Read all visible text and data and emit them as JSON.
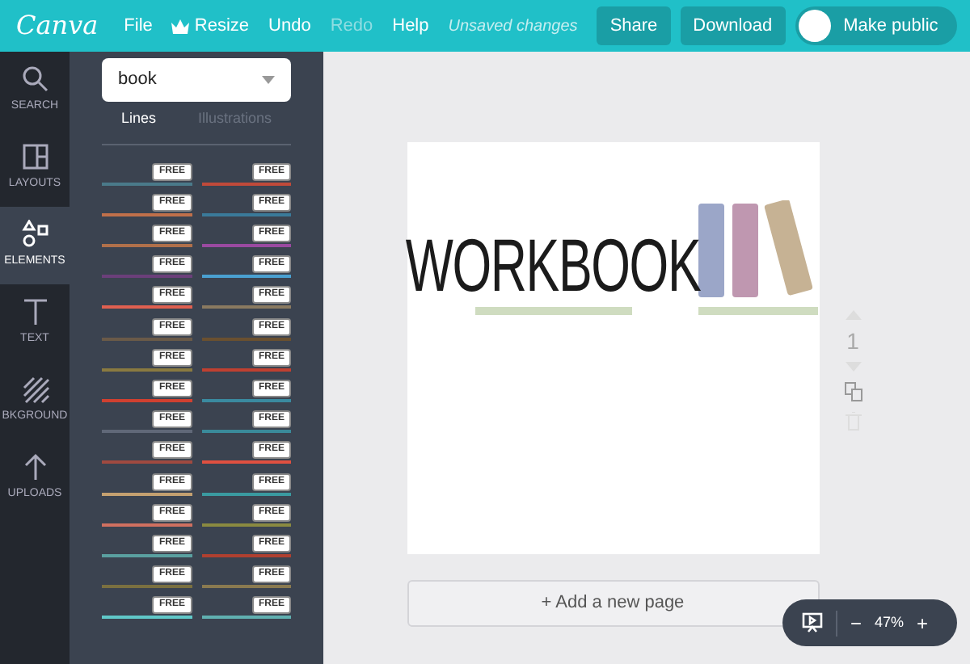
{
  "topbar": {
    "logo": "Canva",
    "menu": [
      {
        "label": "File",
        "disabled": false
      },
      {
        "label": "Resize",
        "disabled": false
      },
      {
        "label": "Undo",
        "disabled": false
      },
      {
        "label": "Redo",
        "disabled": true
      },
      {
        "label": "Help",
        "disabled": false
      }
    ],
    "status": "Unsaved changes",
    "buttons": [
      "Share",
      "Download"
    ],
    "toggle": {
      "label": "Make public",
      "on": false
    }
  },
  "rail": [
    {
      "label": "SEARCH",
      "selected": false
    },
    {
      "label": "LAYOUTS",
      "selected": false
    },
    {
      "label": "ELEMENTS",
      "selected": true
    },
    {
      "label": "TEXT",
      "selected": false
    },
    {
      "label": "BKGROUND",
      "selected": false
    },
    {
      "label": "UPLOADS",
      "selected": false
    }
  ],
  "panel": {
    "search": {
      "value": "book"
    },
    "tabs": [
      {
        "label": "Lines",
        "selected": true
      },
      {
        "label": "Illustrations",
        "selected": false
      }
    ],
    "lines": [
      {
        "badge": "FREE",
        "color": "#4a7a8a"
      },
      {
        "badge": "FREE",
        "color": "#c04a3a"
      },
      {
        "badge": "FREE",
        "color": "#c0704a"
      },
      {
        "badge": "FREE",
        "color": "#3a7a9a"
      },
      {
        "badge": "FREE",
        "color": "#b0704a"
      },
      {
        "badge": "FREE",
        "color": "#9a4aa0"
      },
      {
        "badge": "FREE",
        "color": "#6b3f7a"
      },
      {
        "badge": "FREE",
        "color": "#4aa0d0"
      },
      {
        "badge": "FREE",
        "color": "#e06050"
      },
      {
        "badge": "FREE",
        "color": "#8a7a60"
      },
      {
        "badge": "FREE",
        "color": "#6a5a48"
      },
      {
        "badge": "FREE",
        "color": "#6a5030"
      },
      {
        "badge": "FREE",
        "color": "#8a7a40"
      },
      {
        "badge": "FREE",
        "color": "#c04030"
      },
      {
        "badge": "FREE",
        "color": "#d04030"
      },
      {
        "badge": "FREE",
        "color": "#3a8aa0"
      },
      {
        "badge": "FREE",
        "color": "#606878"
      },
      {
        "badge": "FREE",
        "color": "#3a8a9a"
      },
      {
        "badge": "FREE",
        "color": "#a04a40"
      },
      {
        "badge": "FREE",
        "color": "#e05040"
      },
      {
        "badge": "FREE",
        "color": "#c4a070"
      },
      {
        "badge": "FREE",
        "color": "#3a9aa0"
      },
      {
        "badge": "FREE",
        "color": "#d07060"
      },
      {
        "badge": "FREE",
        "color": "#8a8a40"
      },
      {
        "badge": "FREE",
        "color": "#5aa0a0"
      },
      {
        "badge": "FREE",
        "color": "#b04030"
      },
      {
        "badge": "FREE",
        "color": "#7a7040"
      },
      {
        "badge": "FREE",
        "color": "#8a7a50"
      },
      {
        "badge": "FREE",
        "color": "#60c8c8"
      },
      {
        "badge": "FREE",
        "color": "#60b0b0"
      }
    ]
  },
  "canvas": {
    "title": "WORKBOOK",
    "page_number": "1",
    "add_page": "+ Add a new page"
  },
  "zoom": {
    "value": "47%",
    "minus": "−",
    "plus": "+"
  }
}
